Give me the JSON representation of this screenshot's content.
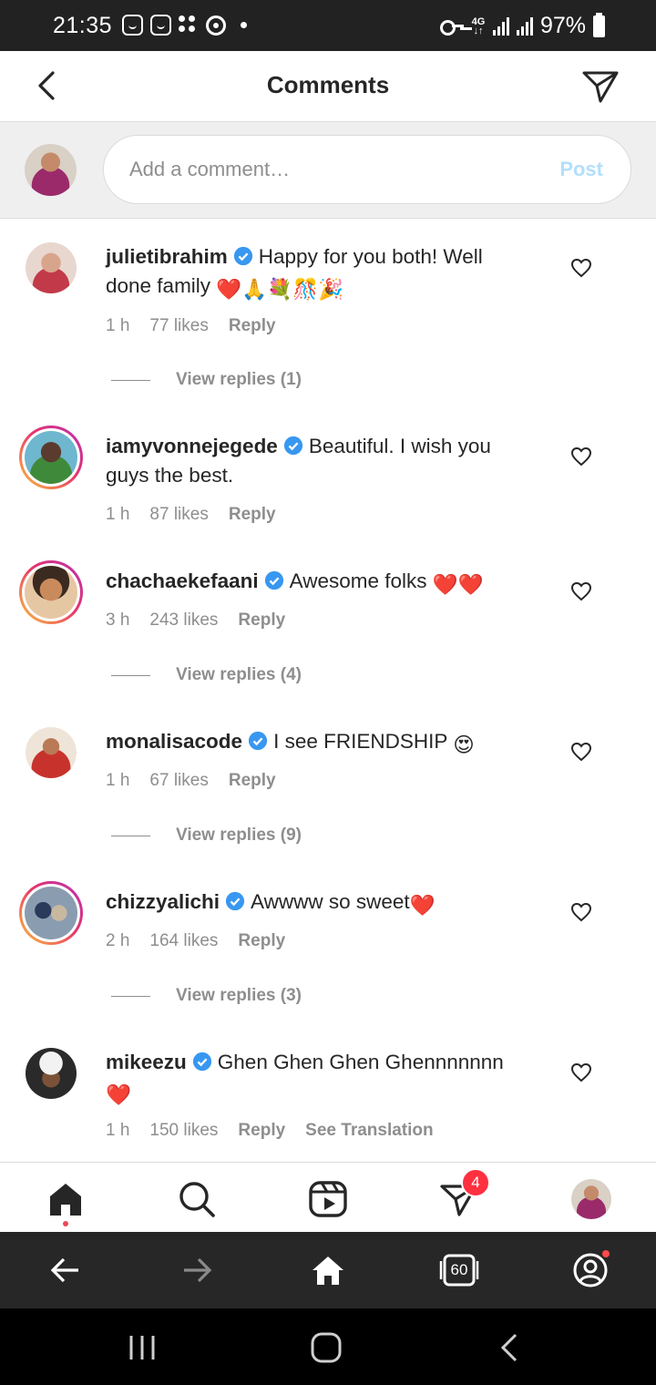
{
  "status_bar": {
    "time": "21:35",
    "network": "4G",
    "battery": "97%"
  },
  "header": {
    "title": "Comments"
  },
  "composer": {
    "placeholder": "Add a comment…",
    "post_label": "Post"
  },
  "comments": [
    {
      "username": "julietibrahim",
      "text": "Happy for you both! Well done family",
      "emojis": "❤️🙏💐🎊🎉",
      "time": "1 h",
      "likes": "77 likes",
      "reply": "Reply",
      "view_replies": "View replies (1)"
    },
    {
      "username": "iamyvonnejegede",
      "text": "Beautiful. I wish you guys the best.",
      "time": "1 h",
      "likes": "87 likes",
      "reply": "Reply"
    },
    {
      "username": "chachaekefaani",
      "text": "Awesome folks",
      "emojis": "❤️❤️",
      "time": "3 h",
      "likes": "243 likes",
      "reply": "Reply",
      "view_replies": "View replies (4)"
    },
    {
      "username": "monalisacode",
      "text": "I see FRIENDSHIP",
      "emojis": "😍",
      "time": "1 h",
      "likes": "67 likes",
      "reply": "Reply",
      "view_replies": "View replies (9)"
    },
    {
      "username": "chizzyalichi",
      "text": "Awwww so sweet",
      "emojis": "❤️",
      "time": "2 h",
      "likes": "164 likes",
      "reply": "Reply",
      "view_replies": "View replies (3)"
    },
    {
      "username": "mikeezu",
      "text": "Ghen Ghen Ghen Ghennnnnnn",
      "emojis": "❤️",
      "time": "1 h",
      "likes": "150 likes",
      "reply": "Reply",
      "see_translation": "See Translation"
    }
  ],
  "bottom_nav": {
    "activity_badge": "4"
  },
  "browser_bar": {
    "tab_count": "60"
  },
  "colors": {
    "verified": "#3897f0",
    "heart_emoji": "#e0142c",
    "badge": "#ff3040",
    "post_disabled": "#b2dffc",
    "muted_text": "#8e8e8e"
  }
}
